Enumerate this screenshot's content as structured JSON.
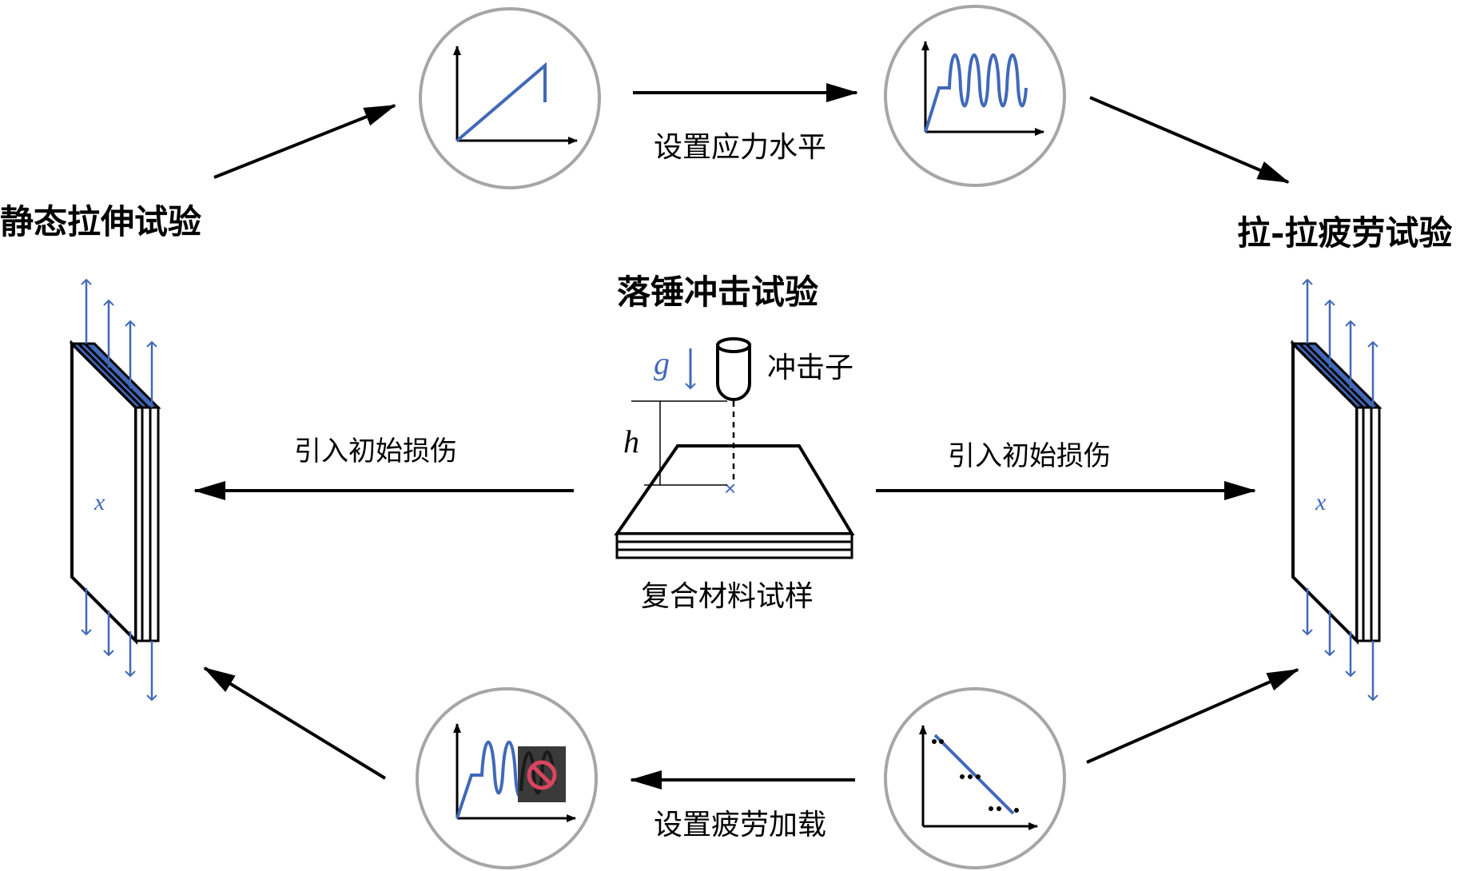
{
  "labels": {
    "static_test": "静态拉伸试验",
    "fatigue_test": "拉-拉疲劳试验",
    "impact_test": "落锤冲击试验",
    "specimen": "复合材料试样",
    "impactor": "冲击子",
    "set_stress": "设置应力水平",
    "set_fatigue": "设置疲劳加载",
    "intro_damage_left": "引入初始损伤",
    "intro_damage_right": "引入初始损伤",
    "gravity_symbol": "g",
    "height_symbol": "h"
  },
  "colors": {
    "blue": "#4169b8",
    "circle_stroke": "#a6a6a6",
    "black": "#000000",
    "dark_box": "#3a3a3a",
    "forbid_red": "#d9455f"
  },
  "icons": {
    "static_curve": "linear-stress-strain-plot-icon",
    "fatigue_wave": "sinusoidal-fatigue-load-icon",
    "fatigue_stop": "stopped-fatigue-load-icon",
    "sn_plot": "s-n-scatter-plot-icon"
  }
}
